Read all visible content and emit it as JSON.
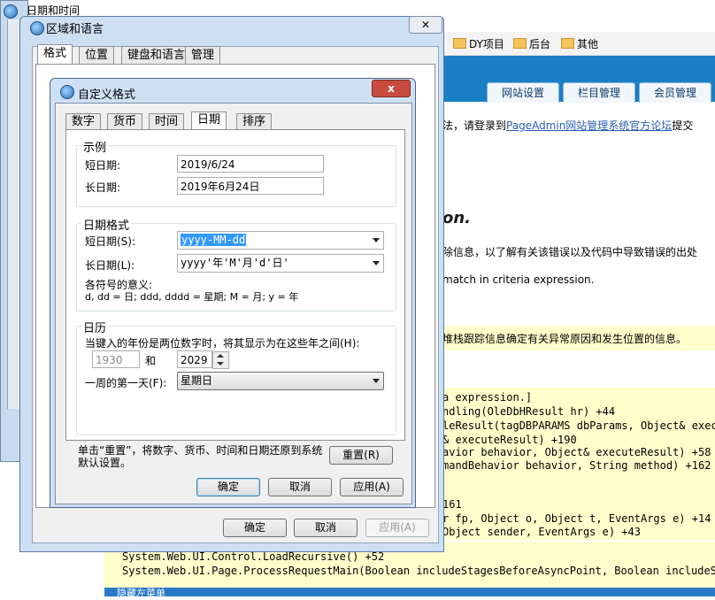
{
  "browser": {
    "bookmarks": [
      "DY项目",
      "后台",
      "其他"
    ],
    "nav_tabs": [
      "网站设置",
      "栏目管理",
      "会员管理"
    ],
    "forum_prefix": "法，请登录到",
    "forum_link": "PageAdmin网站管理系统官方论坛",
    "forum_suffix": "提交",
    "error_heading": "on.",
    "line_debug": "除信息，以了解有关该错误以及代码中导致错误的出处",
    "line_mismatch": "match in criteria expression.",
    "line_stack_info": "堆栈跟踪信息确定有关异常原因和发生位置的信息。",
    "stack_lines": [
      "a expression.]",
      "ndling(OleDbHResult hr) +44",
      "leResult(tagDBPARAMS dbParams, Object& executeR",
      "& executeResult) +190",
      "avior behavior, Object& executeResult) +58",
      "mandBehavior behavior, String method) +162",
      "161",
      "r fp, Object o, Object t, EventArgs e) +14",
      "Object sender, EventArgs e) +43"
    ],
    "stack_bottom": [
      "System.Web.UI.Control.LoadRecursive() +52",
      "System.Web.UI.Page.ProcessRequestMain(Boolean includeStagesBeforeAsyncPoint, Boolean includeStagesAfter"
    ],
    "hidden_menu": "隐藏左菜单"
  },
  "datetime_window": {
    "title": "日期和时间"
  },
  "region_window": {
    "title": "区域和语言",
    "tabs": [
      "格式",
      "位置",
      "键盘和语言",
      "管理"
    ],
    "buttons": {
      "ok": "确定",
      "cancel": "取消",
      "apply": "应用(A)"
    }
  },
  "custom_window": {
    "title": "自定义格式",
    "tabs": [
      "数字",
      "货币",
      "时间",
      "日期",
      "排序"
    ],
    "example": {
      "title": "示例",
      "short_label": "短日期:",
      "short_value": "2019/6/24",
      "long_label": "长日期:",
      "long_value": "2019年6月24日"
    },
    "format": {
      "title": "日期格式",
      "short_label": "短日期(S):",
      "short_value": "yyyy-MM-dd",
      "long_label": "长日期(L):",
      "long_value": "yyyy'年'M'月'd'日'",
      "meaning_title": "各符号的意义:",
      "meaning_text": "d, dd = 日;  ddd, dddd = 星期;  M = 月;  y = 年"
    },
    "calendar": {
      "title": "日历",
      "two_digit_text": "当键入的年份是两位数字时，将其显示为在这些年之间(H):",
      "year_from": "1930",
      "and_label": "和",
      "year_to": "2029",
      "first_day_label": "一周的第一天(F):",
      "first_day_value": "星期日"
    },
    "reset_note": "单击“重置”，将数字、货币、时间和日期还原到系统默认设置。",
    "buttons": {
      "reset": "重置(R)",
      "ok": "确定",
      "cancel": "取消",
      "apply": "应用(A)"
    },
    "close_label": "x"
  }
}
